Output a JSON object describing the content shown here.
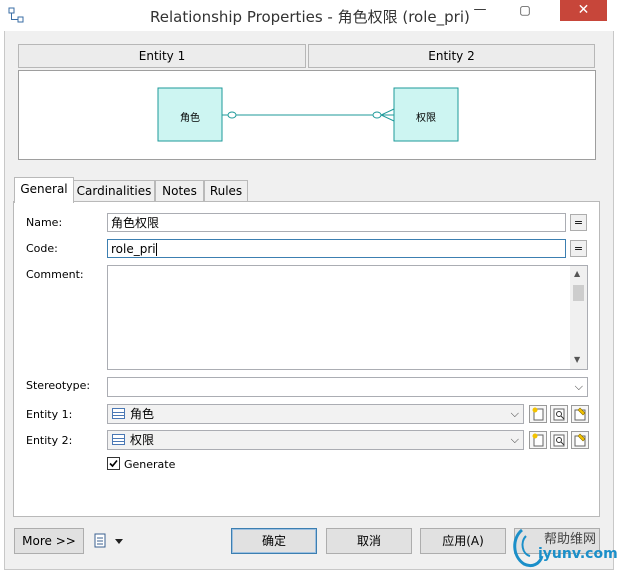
{
  "window": {
    "title": "Relationship Properties - 角色权限 (role_pri)",
    "minimize_glyph": "—",
    "maximize_glyph": "▢",
    "close_glyph": "✕"
  },
  "entities_header": {
    "entity1": "Entity 1",
    "entity2": "Entity 2"
  },
  "diagram": {
    "left_entity": "角色",
    "right_entity": "权限"
  },
  "tabs": [
    {
      "label": "General"
    },
    {
      "label": "Cardinalities"
    },
    {
      "label": "Notes"
    },
    {
      "label": "Rules"
    }
  ],
  "form": {
    "name_label": "Name:",
    "name_value": "角色权限",
    "code_label": "Code:",
    "code_value": "role_pri",
    "comment_label": "Comment:",
    "stereotype_label": "Stereotype:",
    "entity1_label": "Entity 1:",
    "entity1_value": "角色",
    "entity2_label": "Entity 2:",
    "entity2_value": "权限",
    "generate_label": "Generate",
    "generate_checked": true,
    "eq_glyph": "="
  },
  "buttons": {
    "more": "More >>",
    "ok": "确定",
    "cancel": "取消",
    "apply": "应用(A)"
  },
  "watermark": {
    "line1": "帮助维网",
    "line2": "iyunv.com"
  }
}
